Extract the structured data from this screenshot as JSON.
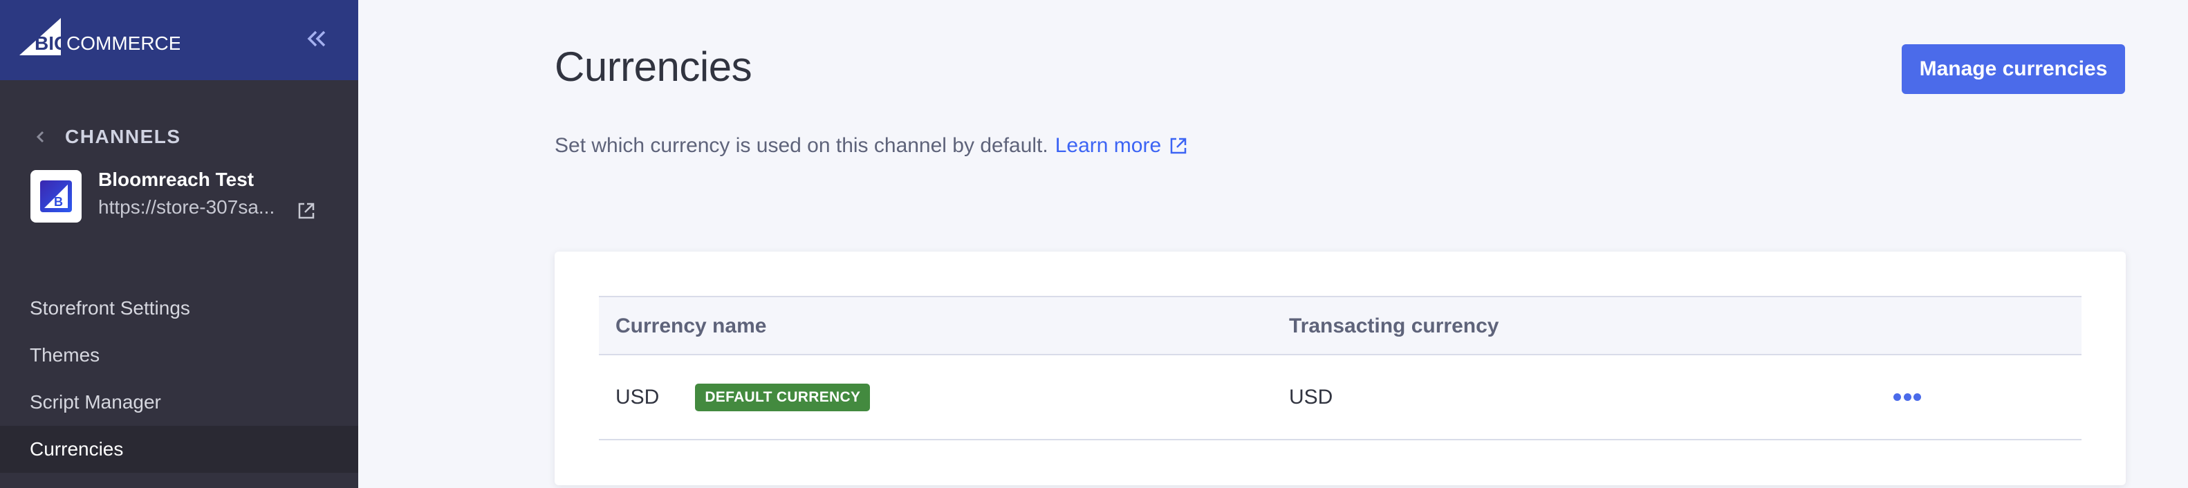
{
  "brand": {
    "logo_text_big": "BIG",
    "logo_text_rest": "COMMERCE",
    "header_color": "#2c3982"
  },
  "sidebar": {
    "back_label": "CHANNELS",
    "channel": {
      "name": "Bloomreach Test",
      "url": "https://store-307sa..."
    },
    "items": [
      {
        "label": "Storefront Settings",
        "active": false
      },
      {
        "label": "Themes",
        "active": false
      },
      {
        "label": "Script Manager",
        "active": false
      },
      {
        "label": "Currencies",
        "active": true
      }
    ]
  },
  "page": {
    "title": "Currencies",
    "subtitle": "Set which currency is used on this channel by default.",
    "learn_more": "Learn more",
    "primary_button": "Manage currencies",
    "accent_color": "#4b6bea"
  },
  "table": {
    "columns": [
      "Currency name",
      "Transacting currency"
    ],
    "rows": [
      {
        "currency_name": "USD",
        "badge": "DEFAULT CURRENCY",
        "transacting_currency": "USD",
        "actions_icon": "more-horizontal-icon"
      }
    ]
  }
}
